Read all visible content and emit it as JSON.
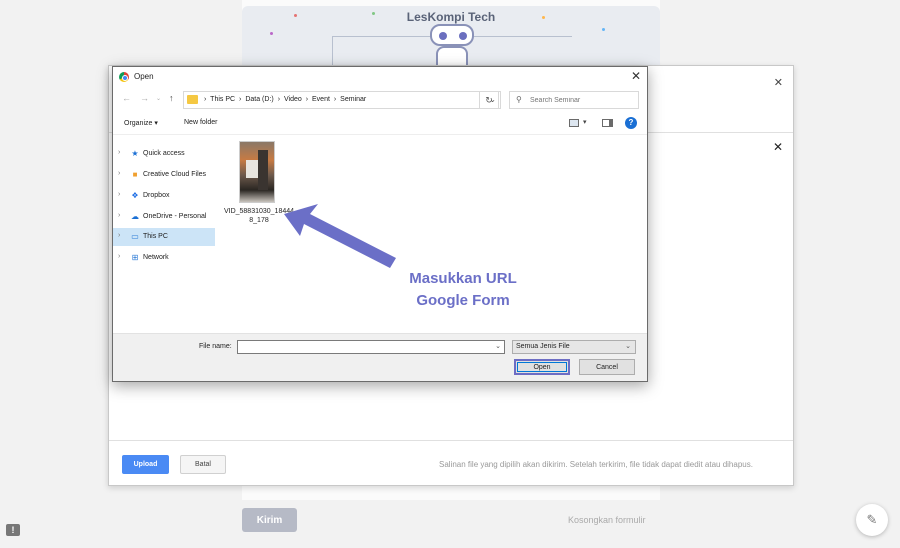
{
  "background_form": {
    "banner_title": "LesKompi Tech",
    "submit_label": "Kirim",
    "clear_label": "Kosongkan formulir",
    "feedback_icon": "!"
  },
  "picker": {
    "upload_label": "Upload",
    "cancel_label": "Batal",
    "footer_note": "Salinan file yang dipilih akan dikirim. Setelah terkirim, file tidak dapat diedit atau dihapus."
  },
  "dialog": {
    "title": "Open",
    "breadcrumb": [
      "This PC",
      "Data (D:)",
      "Video",
      "Event",
      "Seminar"
    ],
    "search_placeholder": "Search Seminar",
    "toolbar": {
      "organize": "Organize",
      "new_folder": "New folder"
    },
    "nav_items": [
      {
        "label": "Quick access",
        "icon": "star-icon",
        "glyph": "★",
        "color": "#1a6fd4",
        "selected": false
      },
      {
        "label": "Creative Cloud Files",
        "icon": "creative-cloud-icon",
        "glyph": "■",
        "color": "#f0a030",
        "selected": false
      },
      {
        "label": "Dropbox",
        "icon": "dropbox-icon",
        "glyph": "❖",
        "color": "#1f6fe5",
        "selected": false
      },
      {
        "label": "OneDrive - Personal",
        "icon": "onedrive-icon",
        "glyph": "☁",
        "color": "#1a6fd4",
        "selected": false
      },
      {
        "label": "This PC",
        "icon": "computer-icon",
        "glyph": "▭",
        "color": "#2a7ad6",
        "selected": true
      },
      {
        "label": "Network",
        "icon": "network-icon",
        "glyph": "⊞",
        "color": "#2a7ad6",
        "selected": false
      }
    ],
    "file": {
      "name": "VID_58831030_184448_178"
    },
    "file_name_label": "File name:",
    "file_name_value": "",
    "file_type": "Semua Jenis File",
    "open_label": "Open",
    "cancel_label": "Cancel"
  },
  "annotation": {
    "line1": "Masukkan URL",
    "line2": "Google Form",
    "color": "#6b6fc7"
  }
}
